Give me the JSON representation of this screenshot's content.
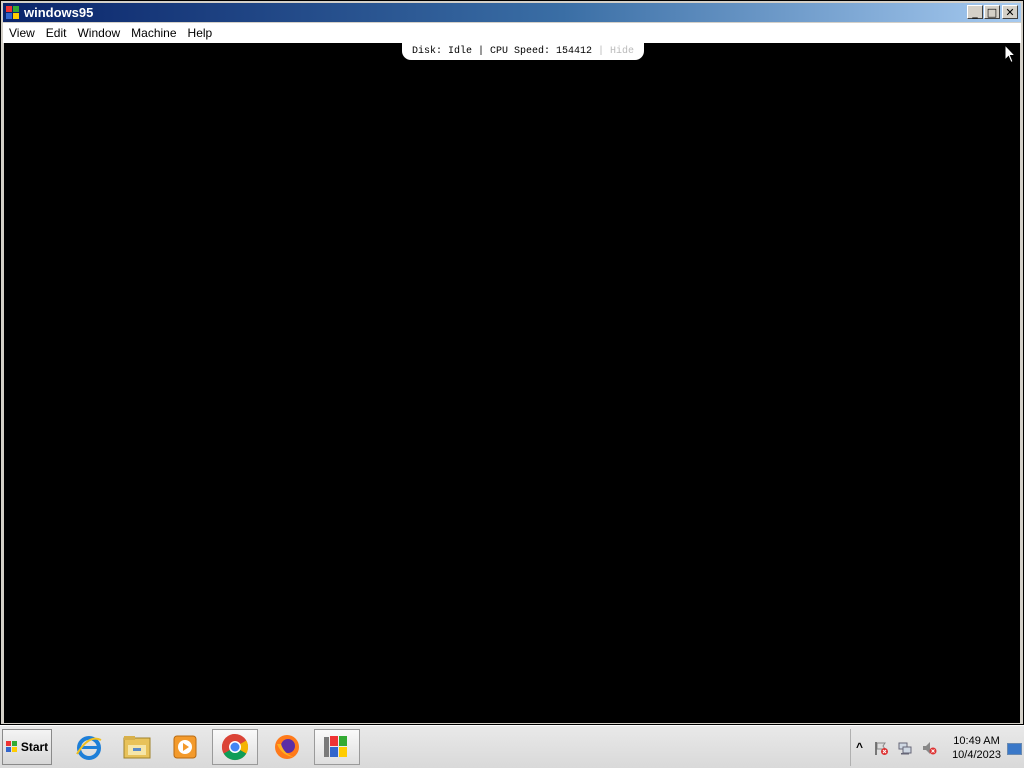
{
  "window": {
    "title": "windows95",
    "controls": {
      "minimize": "_",
      "maximize": "□",
      "close": "✕"
    }
  },
  "menu": [
    "View",
    "Edit",
    "Window",
    "Machine",
    "Help"
  ],
  "status": {
    "disk": "Disk: Idle",
    "cpu": "CPU Speed: 154412",
    "separator": " | ",
    "hide": "Hide"
  },
  "taskbar": {
    "start_label": "Start",
    "apps": [
      "internet-explorer-icon",
      "file-explorer-icon",
      "media-player-icon",
      "chrome-icon",
      "firefox-icon",
      "windows95-app-icon"
    ],
    "tray": {
      "chevron": "^",
      "time": "10:49 AM",
      "date": "10/4/2023"
    }
  },
  "colors": {
    "titlebar_start": "#0a246a",
    "titlebar_end": "#a6caf0",
    "screen": "#000000"
  }
}
